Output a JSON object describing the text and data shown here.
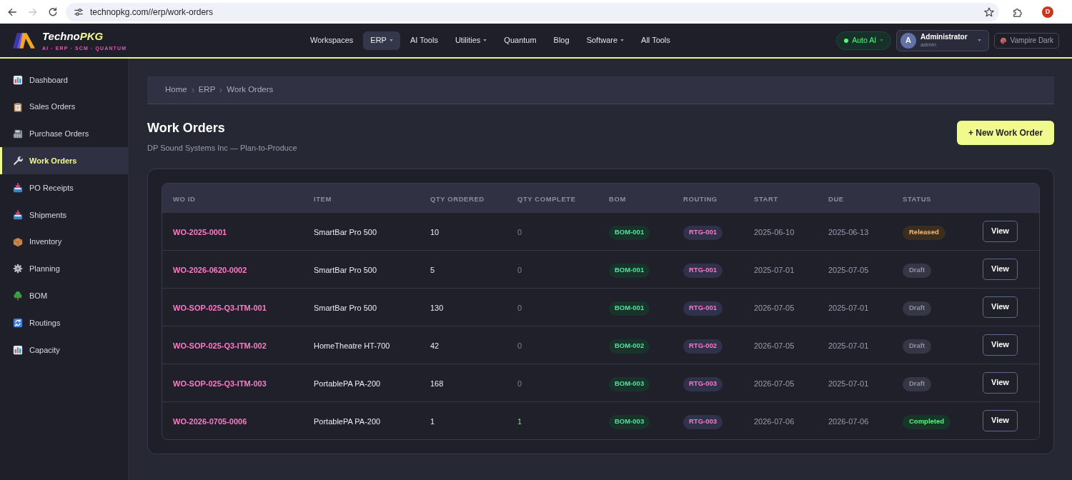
{
  "browser": {
    "url": "technopkg.com//erp/work-orders",
    "forward_enabled": false,
    "profile_initial": "D"
  },
  "header": {
    "brand": {
      "name_parts": [
        "Techno",
        "PKG"
      ],
      "tagline": "AI · ERP · SCM · QUANTUM"
    },
    "nav": [
      {
        "label": "Workspaces",
        "selected": false,
        "has_menu": false
      },
      {
        "label": "ERP",
        "selected": true,
        "has_menu": true
      },
      {
        "label": "AI Tools",
        "selected": false,
        "has_menu": false
      },
      {
        "label": "Utilities",
        "selected": false,
        "has_menu": true
      },
      {
        "label": "Quantum",
        "selected": false,
        "has_menu": false
      },
      {
        "label": "Blog",
        "selected": false,
        "has_menu": false
      },
      {
        "label": "Software",
        "selected": false,
        "has_menu": true
      },
      {
        "label": "All Tools",
        "selected": false,
        "has_menu": false
      }
    ],
    "auto_ai": {
      "label": "Auto AI",
      "on": true
    },
    "user": {
      "initial": "A",
      "name": "Administrator",
      "role": "admin"
    },
    "theme": {
      "label": "Vampire Dark"
    }
  },
  "sidebar": {
    "items": [
      {
        "label": "Dashboard",
        "selected": false
      },
      {
        "label": "Sales Orders",
        "selected": false
      },
      {
        "label": "Purchase Orders",
        "selected": false
      },
      {
        "label": "Work Orders",
        "selected": true
      },
      {
        "label": "PO Receipts",
        "selected": false
      },
      {
        "label": "Shipments",
        "selected": false
      },
      {
        "label": "Inventory",
        "selected": false
      },
      {
        "label": "Planning",
        "selected": false
      },
      {
        "label": "BOM",
        "selected": false
      },
      {
        "label": "Routings",
        "selected": false
      },
      {
        "label": "Capacity",
        "selected": false
      }
    ]
  },
  "breadcrumb": [
    "Home",
    "ERP",
    "Work Orders"
  ],
  "page": {
    "title": "Work Orders",
    "subtitle": "DP Sound Systems Inc — Plan-to-Produce",
    "new_button": "+ New Work Order"
  },
  "table": {
    "columns": [
      "WO ID",
      "ITEM",
      "QTY ORDERED",
      "QTY COMPLETE",
      "BOM",
      "ROUTING",
      "START",
      "DUE",
      "STATUS"
    ],
    "rows": [
      {
        "wo_id": "WO-2025-0001",
        "item": "SmartBar Pro 500",
        "qty_ordered": "10",
        "qty_complete": "0",
        "bom": "BOM-001",
        "routing": "RTG-001",
        "start": "2025-06-10",
        "due": "2025-06-13",
        "status": {
          "label": "Released",
          "kind": "released"
        },
        "action": "View"
      },
      {
        "wo_id": "WO-2026-0620-0002",
        "item": "SmartBar Pro 500",
        "qty_ordered": "5",
        "qty_complete": "0",
        "bom": "BOM-001",
        "routing": "RTG-001",
        "start": "2025-07-01",
        "due": "2025-07-05",
        "status": {
          "label": "Draft",
          "kind": "draft"
        },
        "action": "View"
      },
      {
        "wo_id": "WO-SOP-025-Q3-ITM-001",
        "item": "SmartBar Pro 500",
        "qty_ordered": "130",
        "qty_complete": "0",
        "bom": "BOM-001",
        "routing": "RTG-001",
        "start": "2026-07-05",
        "due": "2025-07-01",
        "status": {
          "label": "Draft",
          "kind": "draft"
        },
        "action": "View"
      },
      {
        "wo_id": "WO-SOP-025-Q3-ITM-002",
        "item": "HomeTheatre HT-700",
        "qty_ordered": "42",
        "qty_complete": "0",
        "bom": "BOM-002",
        "routing": "RTG-002",
        "start": "2026-07-05",
        "due": "2025-07-01",
        "status": {
          "label": "Draft",
          "kind": "draft"
        },
        "action": "View"
      },
      {
        "wo_id": "WO-SOP-025-Q3-ITM-003",
        "item": "PortablePA PA-200",
        "qty_ordered": "168",
        "qty_complete": "0",
        "bom": "BOM-003",
        "routing": "RTG-003",
        "start": "2026-07-05",
        "due": "2025-07-01",
        "status": {
          "label": "Draft",
          "kind": "draft"
        },
        "action": "View"
      },
      {
        "wo_id": "WO-2026-0705-0006",
        "item": "PortablePA PA-200",
        "qty_ordered": "1",
        "qty_complete": "1",
        "bom": "BOM-003",
        "routing": "RTG-003",
        "start": "2026-07-06",
        "due": "2026-07-06",
        "status": {
          "label": "Completed",
          "kind": "completed"
        },
        "action": "View"
      }
    ]
  }
}
